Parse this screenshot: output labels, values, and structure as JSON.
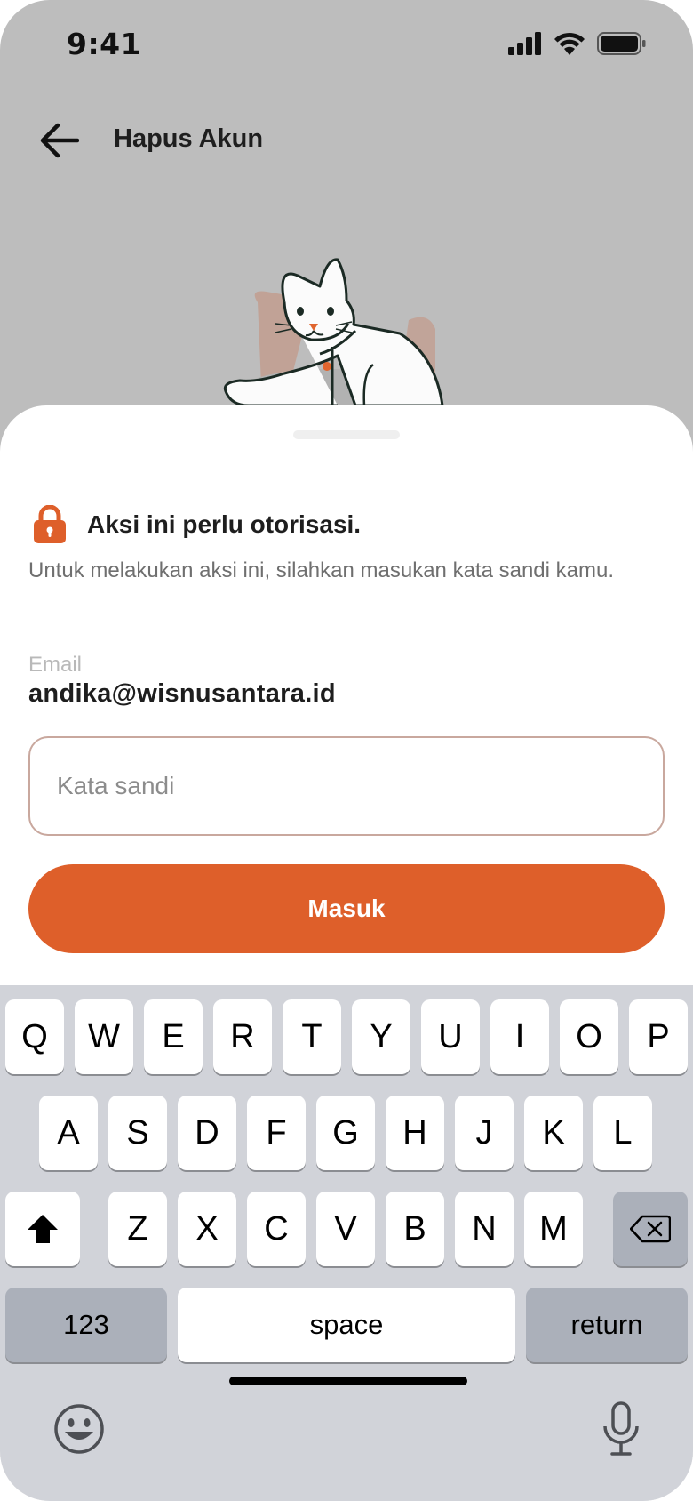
{
  "status_bar": {
    "time": "9:41"
  },
  "header": {
    "title": "Hapus Akun"
  },
  "sheet": {
    "auth_title": "Aksi ini perlu otorisasi.",
    "auth_description": "Untuk melakukan aksi ini, silahkan masukan kata sandi kamu.",
    "email_label": "Email",
    "email_value": "andika@wisnusantara.id",
    "password_placeholder": "Kata sandi",
    "password_value": "",
    "login_label": "Masuk"
  },
  "keyboard": {
    "row1": [
      "Q",
      "W",
      "E",
      "R",
      "T",
      "Y",
      "U",
      "I",
      "O",
      "P"
    ],
    "row2": [
      "A",
      "S",
      "D",
      "F",
      "G",
      "H",
      "J",
      "K",
      "L"
    ],
    "row3": [
      "Z",
      "X",
      "C",
      "V",
      "B",
      "N",
      "M"
    ],
    "numbers_label": "123",
    "space_label": "space",
    "return_label": "return"
  },
  "colors": {
    "accent": "#de5f2a",
    "backdrop": "#bdbdbd",
    "keyboard": "#d1d3d9"
  }
}
